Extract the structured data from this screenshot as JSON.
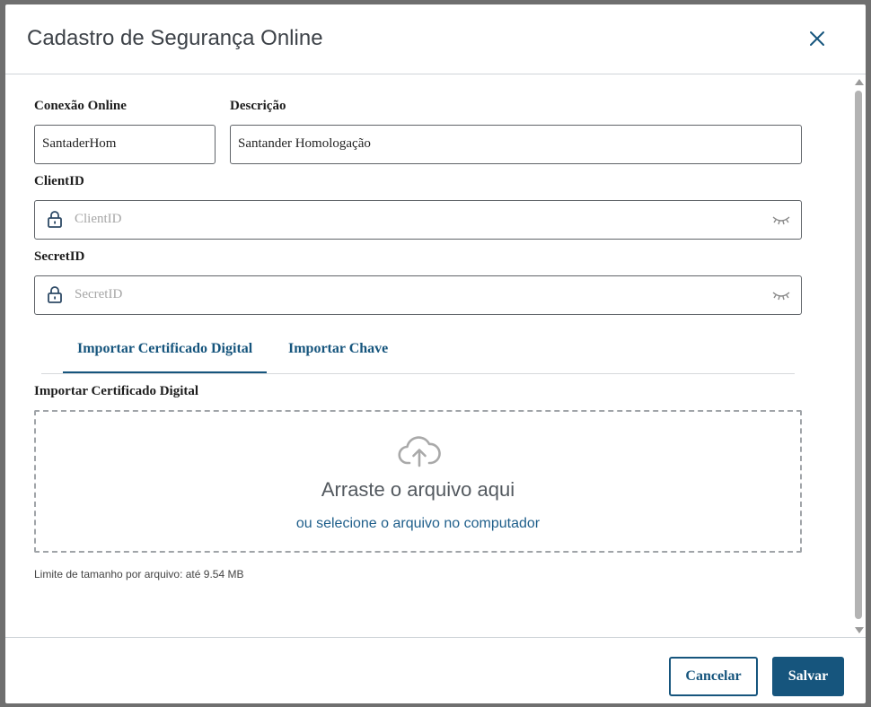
{
  "dialog": {
    "title": "Cadastro de Segurança Online"
  },
  "form": {
    "conexao_label": "Conexão Online",
    "conexao_value": "SantaderHom",
    "descricao_label": "Descrição",
    "descricao_value": "Santander Homologação",
    "clientid_label": "ClientID",
    "clientid_placeholder": "ClientID",
    "secretid_label": "SecretID",
    "secretid_placeholder": "SecretID"
  },
  "tabs": [
    {
      "label": "Importar Certificado Digital",
      "active": true
    },
    {
      "label": "Importar Chave",
      "active": false
    }
  ],
  "upload": {
    "section_label": "Importar Certificado Digital",
    "drop_text": "Arraste o arquivo aqui",
    "select_link": "ou selecione o arquivo no computador",
    "size_limit": "Limite de tamanho por arquivo: até 9.54 MB"
  },
  "footer": {
    "cancel_label": "Cancelar",
    "save_label": "Salvar"
  },
  "icons": {
    "close": "close-icon",
    "lock": "lock-icon",
    "eye": "eye-closed-icon",
    "upload": "cloud-upload-icon"
  },
  "colors": {
    "primary": "#16557d",
    "text": "#1d1d1d",
    "placeholder": "#a6a6a6",
    "border": "#5f6368",
    "backdrop": "#6f6f6f"
  }
}
